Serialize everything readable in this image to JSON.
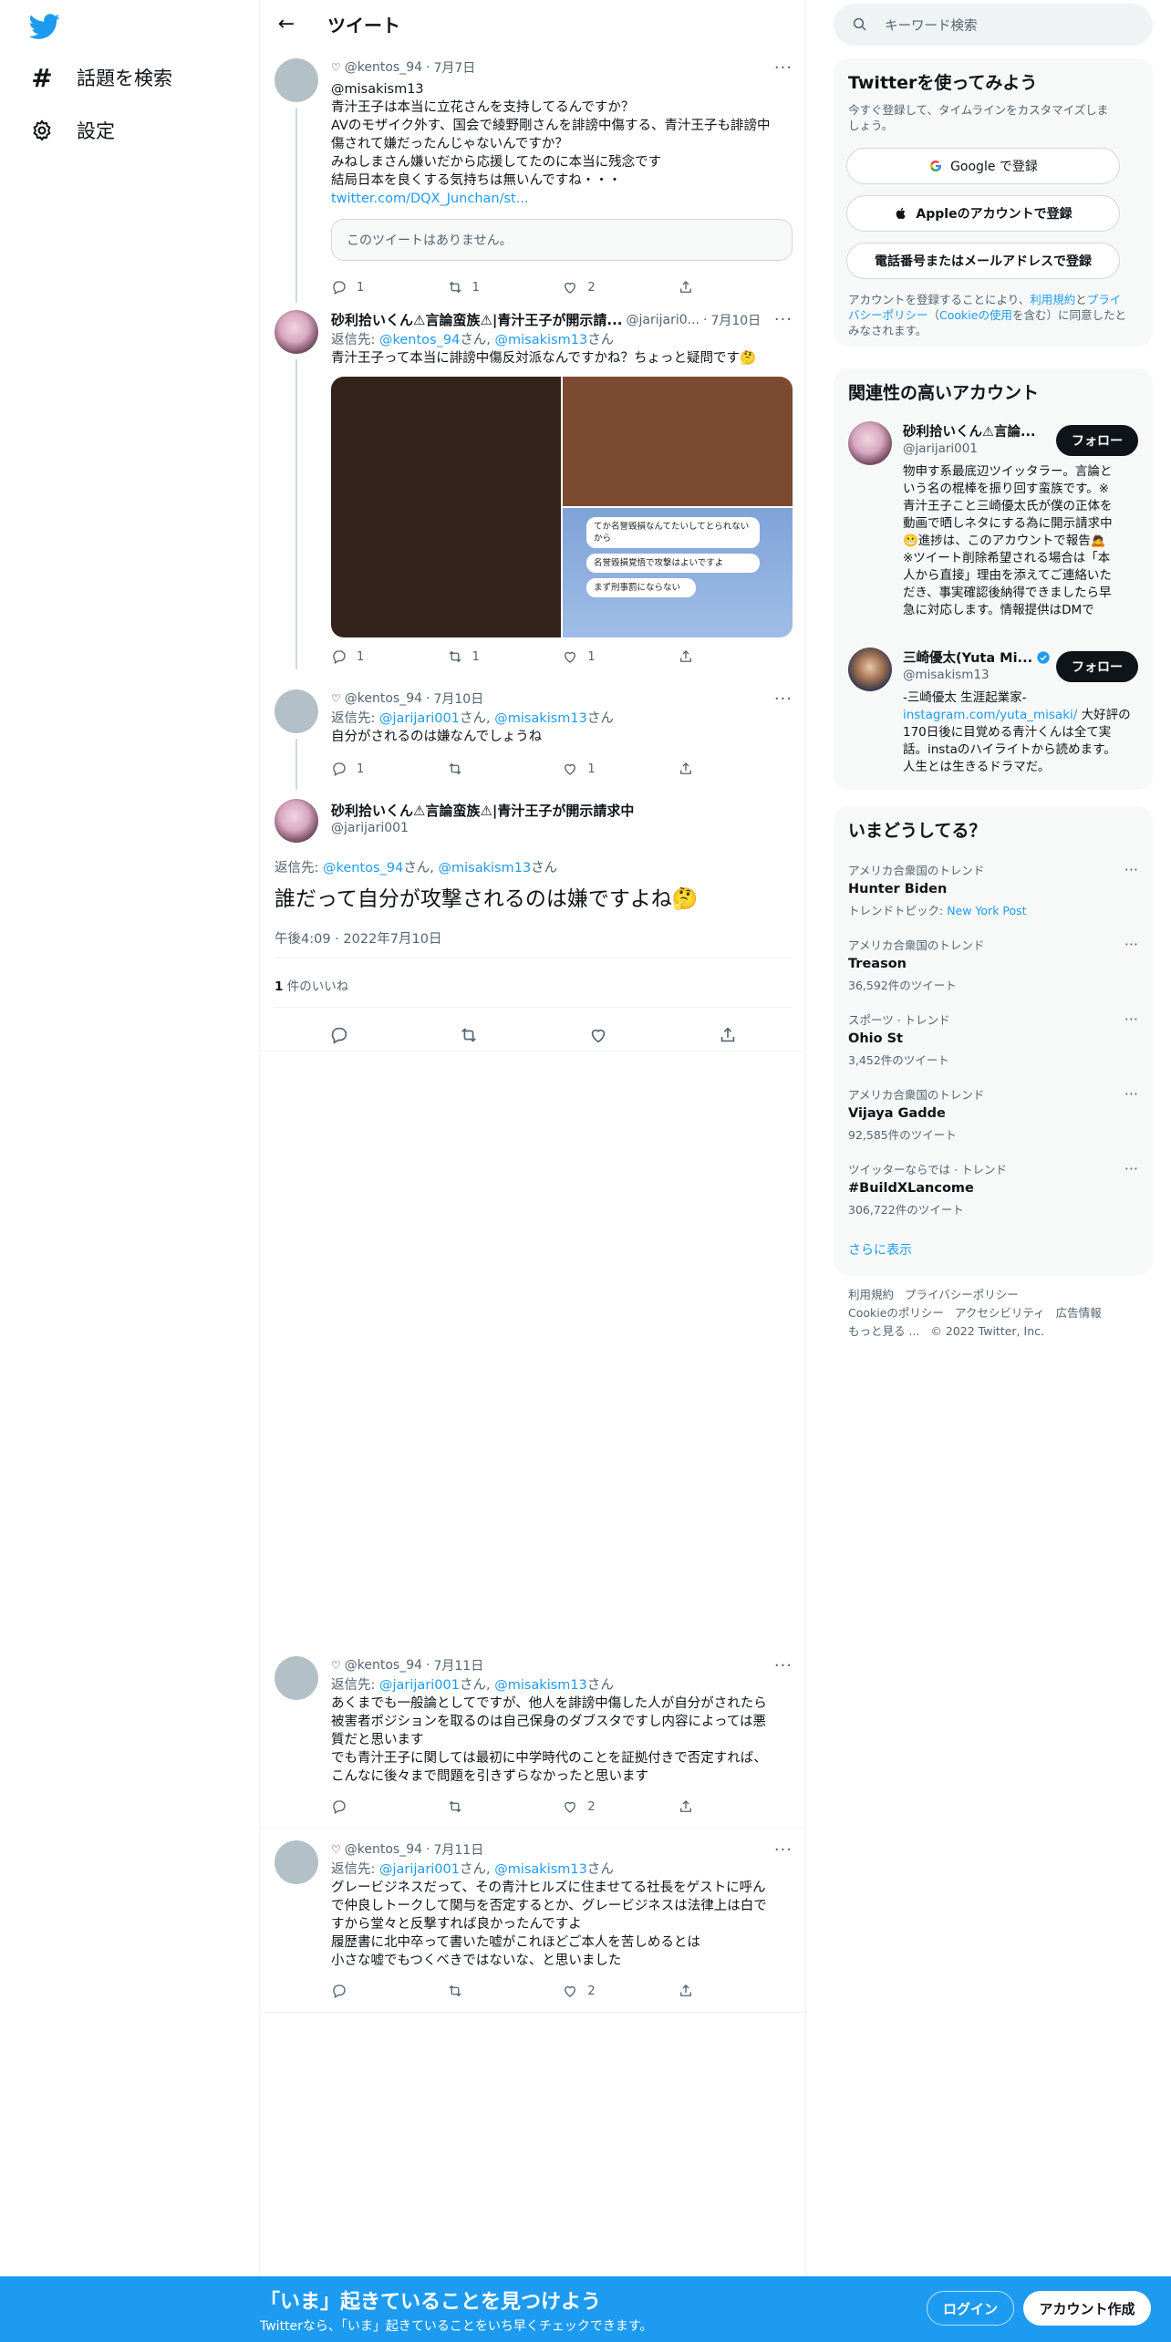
{
  "nav": {
    "explore_label": "話題を検索",
    "settings_label": "設定"
  },
  "header": {
    "title": "ツイート"
  },
  "tweets": [
    {
      "user": "@kentos_94",
      "date": "7月7日",
      "reply_to_line": "@misakism13",
      "lines": [
        "青汁王子は本当に立花さんを支持してるんですか？",
        "AVのモザイク外す、国会で綾野剛さんを誹謗中傷する、青汁王子も誹謗中",
        "傷されて嫌だったんじゃないんですか？",
        "みねしまさん嫌いだから応援してたのに本当に残念です",
        "結局日本を良くする気持ちは無いんですね・・・"
      ],
      "link": "twitter.com/DQX_Junchan/st...",
      "quote_unavailable": "このツイートはありません。",
      "replies": "1",
      "retweets": "1",
      "likes": "2"
    },
    {
      "name": "砂利拾いくん⚠言論蛮族⚠|青汁王子が開示請...",
      "handle": "@jarijari0...",
      "date": "7月10日",
      "reply_prefix": "返信先: ",
      "reply_to_1": "@kentos_94",
      "reply_san_1": "さん, ",
      "reply_to_2": "@misakism13",
      "reply_san_2": "さん",
      "text": "青汁王子って本当に誹謗中傷反対派なんですかね？ちょっと疑問です🤔",
      "chat_bubbles": [
        "てか名誉毀損なんてたいしてとられないから",
        "名誉毀損覚悟で攻撃はよいですよ",
        "まず刑事罰にならない"
      ],
      "replies": "1",
      "retweets": "1",
      "likes": "1"
    },
    {
      "user": "@kentos_94",
      "date": "7月10日",
      "reply_prefix": "返信先: ",
      "reply_to_1": "@jarijari001",
      "reply_san_1": "さん, ",
      "reply_to_2": "@misakism13",
      "reply_san_2": "さん",
      "text": "自分がされるのは嫌なんでしょうね",
      "replies": "1",
      "retweets": "",
      "likes": "1"
    }
  ],
  "focal": {
    "name": "砂利拾いくん⚠言論蛮族⚠|青汁王子が開示請求中",
    "handle": "@jarijari001",
    "reply_prefix": "返信先: ",
    "reply_to_1": "@kentos_94",
    "reply_san_1": "さん, ",
    "reply_to_2": "@misakism13",
    "reply_san_2": "さん",
    "text": "誰だって自分が攻撃されるのは嫌ですよね🤔",
    "timestamp": "午後4:09 · 2022年7月10日",
    "likes_count": "1",
    "likes_label": " 件のいいね"
  },
  "replies": [
    {
      "user": "@kentos_94",
      "date": "7月11日",
      "reply_prefix": "返信先: ",
      "reply_to_1": "@jarijari001",
      "reply_san_1": "さん, ",
      "reply_to_2": "@misakism13",
      "reply_san_2": "さん",
      "lines": [
        "あくまでも一般論としてですが、他人を誹謗中傷した人が自分がされたら",
        "被害者ポジションを取るのは自己保身のダブスタですし内容によっては悪",
        "質だと思います",
        "でも青汁王子に関しては最初に中学時代のことを証拠付きで否定すれば、",
        "こんなに後々まで問題を引きずらなかったと思います"
      ],
      "replies": "",
      "retweets": "",
      "likes": "2"
    },
    {
      "user": "@kentos_94",
      "date": "7月11日",
      "reply_prefix": "返信先: ",
      "reply_to_1": "@jarijari001",
      "reply_san_1": "さん, ",
      "reply_to_2": "@misakism13",
      "reply_san_2": "さん",
      "lines": [
        "グレービジネスだって、その青汁ヒルズに住ませてる社長をゲストに呼ん",
        "で仲良しトークして関与を否定するとか、グレービジネスは法律上は白で",
        "すから堂々と反撃すれば良かったんですよ",
        "履歴書に北中卒って書いた嘘がこれほどご本人を苦しめるとは",
        "小さな嘘でもつくべきではないな、と思いました"
      ],
      "replies": "",
      "retweets": "",
      "likes": "2"
    }
  ],
  "search": {
    "placeholder": "キーワード検索"
  },
  "signup": {
    "title": "Twitterを使ってみよう",
    "subtitle_1": "今すぐ登録して、タイムラインをカスタマイズしま",
    "subtitle_2": "しょう。",
    "google": "Google で登録",
    "apple": "Appleのアカウントで登録",
    "phone": "電話番号またはメールアドレスで登録",
    "terms_1": "アカウントを登録することにより、",
    "terms_link_1": "利用規約",
    "terms_2": "と",
    "terms_link_2": "プライ",
    "terms_link_3": "バシーポリシー",
    "terms_3": "（",
    "terms_link_4": "Cookieの使用",
    "terms_4": "を含む）に同意したと",
    "terms_5": "みなされます。"
  },
  "related": {
    "title": "関連性の高いアカウント",
    "follow_label": "フォロー",
    "accounts": [
      {
        "name": "砂利拾いくん⚠言論...",
        "handle": "@jarijari001",
        "bio_lines": [
          "物申す系最底辺ツイッタラー。言論と",
          "いう名の棍棒を振り回す蛮族です。※",
          "青汁王子こと三崎優太氏が僕の正体を",
          "動画で晒しネタにする為に開示請求中",
          "😬進捗は、このアカウントで報告🙇",
          "※ツイート削除希望される場合は「本",
          "人から直接」理由を添えてご連絡いた",
          "だき、事実確認後納得できましたら早",
          "急に対応します。情報提供はDMで"
        ]
      },
      {
        "name": "三崎優太(Yuta Mi...",
        "handle": "@misakism13",
        "bio_line_1": "-三崎優太 生涯起業家-",
        "bio_link": "instagram.com/yuta_misaki/",
        "bio_after_link": " 大好評の",
        "bio_lines": [
          "170日後に目覚める青汁くんは全て実",
          "話。instaのハイライトから読めます。",
          "人生とは生きるドラマだ。"
        ]
      }
    ]
  },
  "trends": {
    "title": "いまどうしてる？",
    "items": [
      {
        "category": "アメリカ合衆国のトレンド",
        "name": "Hunter Biden",
        "extra_prefix": "トレンドトピック: ",
        "extra_link": "New York Post"
      },
      {
        "category": "アメリカ合衆国のトレンド",
        "name": "Treason",
        "count": "36,592件のツイート"
      },
      {
        "category": "スポーツ · トレンド",
        "name": "Ohio St",
        "count": "3,452件のツイート"
      },
      {
        "category": "アメリカ合衆国のトレンド",
        "name": "Vijaya Gadde",
        "count": "92,585件のツイート"
      },
      {
        "category": "ツイッターならでは · トレンド",
        "name": "#BuildXLancome",
        "count": "306,722件のツイート"
      }
    ],
    "show_more": "さらに表示"
  },
  "footer": {
    "terms": "利用規約",
    "privacy": "プライバシーポリシー",
    "cookie": "Cookieのポリシー",
    "accessibility": "アクセシビリティ",
    "ads": "広告情報",
    "more": "もっと見る ...",
    "copyright": "© 2022 Twitter, Inc."
  },
  "bottombar": {
    "title": "「いま」起きていることを見つけよう",
    "subtitle": "Twitterなら、「いま」起きていることをいち早くチェックできます。",
    "login": "ログイン",
    "signup": "アカウント作成"
  },
  "colors": {
    "accent": "#1d9bf0",
    "text": "#0f1419",
    "muted": "#536471"
  }
}
